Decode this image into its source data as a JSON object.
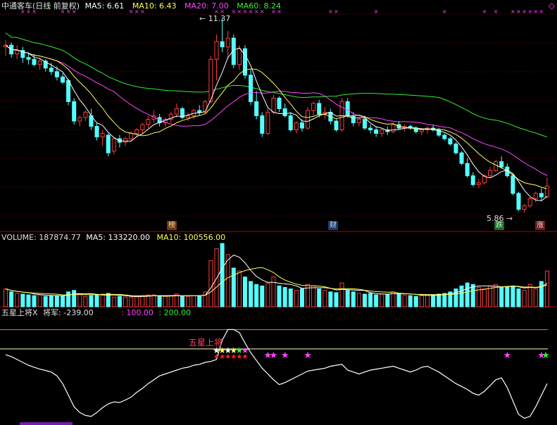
{
  "header": {
    "title": "中通客车(日线 前复权)",
    "ma5_label": "MA5: 6.61",
    "ma10_label": "MA10: 6.43",
    "ma20_label": "MA20: 7.00",
    "ma60_label": "MA60: 8.24"
  },
  "volume_header": {
    "volume_label": "VOLUME: 187874.77",
    "ma5_label": "MA5: 133220.00",
    "ma10_label": "MA10: 100556.00"
  },
  "indicator_header": {
    "name_label": "五星上将X",
    "value_label": "将军: -239.00",
    "level1_label": ": 100.00",
    "level2_label": ": 200.00",
    "star_text": "五星上将"
  },
  "annotations": {
    "high_price": "11.37",
    "low_price": "5.86",
    "tags": [
      "榜",
      "财",
      "跌",
      "涨"
    ]
  },
  "colors": {
    "up": "#ff3c3c",
    "down": "#54ffff",
    "ma5": "#ffffff",
    "ma10": "#ffff55",
    "ma20": "#ff44ff",
    "ma60": "#33ee33",
    "grid": "#8b0000",
    "title": "#e0e0e0",
    "cross": "#ff44ff"
  },
  "chart_data": {
    "type": "candlestick",
    "title": "中通客车(日线 前复权)",
    "price_high": 11.37,
    "price_low": 5.86,
    "ma_last": {
      "MA5": 6.61,
      "MA10": 6.43,
      "MA20": 7.0,
      "MA60": 8.24
    },
    "volume_last": 187874.77,
    "volume_ma_last": {
      "MA5": 133220.0,
      "MA10": 100556.0
    },
    "indicator_levels": [
      100,
      200
    ],
    "indicator_last": -239,
    "candles": [
      [
        10.55,
        10.75,
        10.3,
        10.6
      ],
      [
        10.6,
        10.68,
        10.25,
        10.35
      ],
      [
        10.35,
        10.6,
        10.2,
        10.45
      ],
      [
        10.45,
        10.55,
        10.1,
        10.25
      ],
      [
        10.25,
        10.4,
        10.05,
        10.2
      ],
      [
        10.2,
        10.35,
        10.0,
        10.05
      ],
      [
        10.05,
        10.25,
        9.9,
        10.15
      ],
      [
        10.15,
        10.2,
        9.85,
        9.95
      ],
      [
        9.95,
        10.1,
        9.75,
        9.85
      ],
      [
        9.85,
        10.0,
        9.6,
        9.7
      ],
      [
        9.7,
        9.8,
        9.5,
        9.55
      ],
      [
        9.6,
        9.65,
        8.9,
        9.0
      ],
      [
        9.0,
        9.1,
        8.35,
        8.45
      ],
      [
        8.45,
        8.6,
        8.3,
        8.55
      ],
      [
        8.55,
        8.75,
        8.45,
        8.7
      ],
      [
        8.6,
        8.8,
        8.2,
        8.3
      ],
      [
        8.3,
        8.4,
        7.9,
        8.0
      ],
      [
        8.0,
        8.2,
        7.75,
        8.1
      ],
      [
        8.05,
        8.1,
        7.45,
        7.55
      ],
      [
        7.6,
        8.0,
        7.5,
        7.95
      ],
      [
        7.95,
        8.05,
        7.7,
        7.85
      ],
      [
        7.85,
        8.0,
        7.75,
        7.95
      ],
      [
        7.95,
        8.15,
        7.9,
        8.1
      ],
      [
        8.1,
        8.25,
        8.0,
        8.2
      ],
      [
        8.2,
        8.4,
        8.1,
        8.35
      ],
      [
        8.35,
        8.6,
        8.25,
        8.5
      ],
      [
        8.5,
        8.75,
        8.4,
        8.6
      ],
      [
        8.55,
        8.65,
        8.3,
        8.4
      ],
      [
        8.4,
        8.55,
        8.3,
        8.5
      ],
      [
        8.5,
        8.7,
        8.4,
        8.65
      ],
      [
        8.65,
        8.95,
        8.55,
        8.8
      ],
      [
        8.8,
        8.85,
        8.5,
        8.55
      ],
      [
        8.55,
        8.7,
        8.45,
        8.6
      ],
      [
        8.6,
        8.8,
        8.5,
        8.75
      ],
      [
        8.75,
        8.9,
        8.6,
        8.7
      ],
      [
        8.7,
        9.05,
        8.65,
        9.0
      ],
      [
        9.0,
        10.3,
        8.95,
        10.2
      ],
      [
        10.2,
        10.9,
        9.6,
        10.7
      ],
      [
        10.7,
        11.37,
        10.4,
        10.55
      ],
      [
        10.55,
        11.0,
        10.2,
        10.8
      ],
      [
        10.8,
        10.9,
        9.95,
        10.05
      ],
      [
        10.05,
        10.6,
        9.9,
        10.5
      ],
      [
        10.5,
        10.6,
        9.65,
        9.75
      ],
      [
        9.75,
        9.9,
        8.9,
        9.0
      ],
      [
        9.0,
        9.3,
        8.5,
        8.6
      ],
      [
        8.6,
        8.7,
        8.0,
        8.1
      ],
      [
        8.1,
        8.8,
        8.05,
        8.7
      ],
      [
        8.7,
        9.2,
        8.65,
        9.1
      ],
      [
        9.1,
        9.15,
        8.7,
        8.8
      ],
      [
        8.8,
        8.95,
        8.55,
        8.6
      ],
      [
        8.6,
        8.7,
        8.15,
        8.2
      ],
      [
        8.2,
        8.45,
        8.1,
        8.4
      ],
      [
        8.4,
        8.5,
        8.15,
        8.25
      ],
      [
        8.25,
        8.85,
        8.2,
        8.75
      ],
      [
        8.75,
        9.0,
        8.6,
        8.95
      ],
      [
        8.95,
        9.05,
        8.55,
        8.65
      ],
      [
        8.65,
        8.85,
        8.5,
        8.7
      ],
      [
        8.7,
        8.8,
        8.35,
        8.45
      ],
      [
        8.45,
        8.5,
        8.15,
        8.2
      ],
      [
        8.2,
        9.1,
        8.15,
        9.0
      ],
      [
        9.0,
        9.1,
        8.55,
        8.6
      ],
      [
        8.6,
        8.7,
        8.3,
        8.4
      ],
      [
        8.4,
        8.55,
        8.3,
        8.5
      ],
      [
        8.5,
        8.6,
        8.2,
        8.25
      ],
      [
        8.25,
        8.35,
        8.1,
        8.2
      ],
      [
        8.2,
        8.3,
        8.0,
        8.1
      ],
      [
        8.1,
        8.25,
        8.0,
        8.2
      ],
      [
        8.2,
        8.3,
        8.05,
        8.15
      ],
      [
        8.15,
        8.4,
        8.1,
        8.35
      ],
      [
        8.35,
        8.45,
        8.2,
        8.25
      ],
      [
        8.25,
        8.35,
        8.15,
        8.3
      ],
      [
        8.3,
        8.35,
        8.2,
        8.25
      ],
      [
        8.25,
        8.3,
        8.1,
        8.15
      ],
      [
        8.15,
        8.25,
        8.05,
        8.2
      ],
      [
        8.2,
        8.3,
        8.1,
        8.25
      ],
      [
        8.25,
        8.35,
        8.15,
        8.2
      ],
      [
        8.2,
        8.25,
        8.0,
        8.05
      ],
      [
        8.05,
        8.1,
        7.9,
        7.95
      ],
      [
        7.95,
        8.0,
        7.75,
        7.8
      ],
      [
        7.8,
        7.85,
        7.5,
        7.55
      ],
      [
        7.55,
        7.6,
        7.2,
        7.25
      ],
      [
        7.25,
        7.4,
        6.85,
        6.9
      ],
      [
        6.9,
        7.0,
        6.6,
        6.65
      ],
      [
        6.65,
        6.8,
        6.55,
        6.7
      ],
      [
        6.7,
        6.95,
        6.65,
        6.9
      ],
      [
        6.9,
        7.15,
        6.85,
        7.05
      ],
      [
        7.05,
        7.35,
        7.0,
        7.3
      ],
      [
        7.3,
        7.45,
        7.1,
        7.15
      ],
      [
        7.15,
        7.25,
        6.85,
        6.9
      ],
      [
        6.9,
        6.95,
        6.35,
        6.4
      ],
      [
        6.4,
        6.45,
        5.9,
        5.95
      ],
      [
        5.95,
        6.1,
        5.86,
        6.05
      ],
      [
        6.05,
        6.3,
        6.0,
        6.25
      ],
      [
        6.25,
        6.45,
        6.15,
        6.4
      ],
      [
        6.4,
        6.55,
        6.2,
        6.3
      ],
      [
        6.3,
        6.85,
        6.25,
        6.61
      ]
    ],
    "volumes": [
      24,
      20,
      18,
      17,
      16,
      15,
      16,
      14,
      15,
      15,
      14,
      20,
      22,
      17,
      14,
      15,
      16,
      17,
      18,
      13,
      14,
      13,
      13,
      14,
      15,
      16,
      16,
      14,
      14,
      15,
      17,
      14,
      14,
      15,
      15,
      20,
      62,
      78,
      85,
      70,
      52,
      48,
      40,
      34,
      30,
      28,
      32,
      40,
      28,
      26,
      24,
      22,
      24,
      30,
      28,
      24,
      22,
      20,
      19,
      32,
      22,
      20,
      18,
      17,
      18,
      16,
      17,
      17,
      20,
      18,
      16,
      15,
      14,
      15,
      16,
      16,
      17,
      18,
      20,
      24,
      28,
      32,
      30,
      26,
      24,
      28,
      30,
      26,
      26,
      28,
      24,
      22,
      30,
      24,
      34,
      48
    ],
    "indicator": [
      70,
      60,
      45,
      30,
      15,
      5,
      -5,
      -12,
      -20,
      -40,
      -80,
      -140,
      -200,
      -230,
      -245,
      -250,
      -230,
      -205,
      -185,
      -175,
      -178,
      -165,
      -150,
      -125,
      -105,
      -80,
      -60,
      -40,
      -30,
      -20,
      -10,
      0,
      5,
      15,
      20,
      30,
      35,
      45,
      145,
      200,
      200,
      185,
      130,
      80,
      40,
      0,
      -30,
      -60,
      -85,
      -75,
      -60,
      -45,
      -30,
      -15,
      -10,
      -5,
      0,
      10,
      15,
      20,
      -10,
      -20,
      -30,
      -20,
      -10,
      -5,
      0,
      5,
      10,
      0,
      -10,
      -20,
      -10,
      5,
      10,
      -5,
      -20,
      -40,
      -60,
      -80,
      -95,
      -110,
      -130,
      -140,
      -120,
      -90,
      -60,
      -50,
      -100,
      -170,
      -240,
      -260,
      -250,
      -200,
      -140,
      -80
    ],
    "y_range": [
      5.7,
      11.6
    ]
  }
}
